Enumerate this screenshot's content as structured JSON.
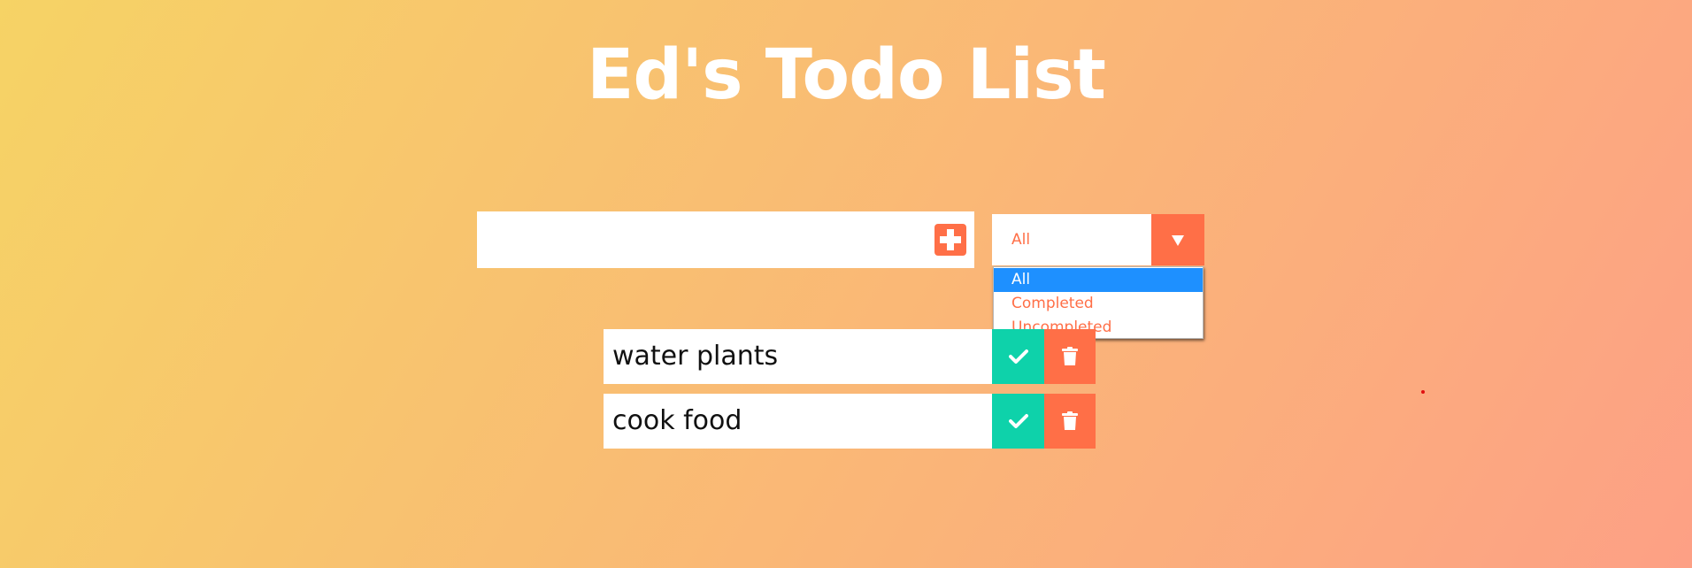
{
  "header": {
    "title": "Ed's Todo List"
  },
  "form": {
    "input_value": "",
    "input_placeholder": "",
    "add_icon": "plus-square-icon"
  },
  "filter": {
    "selected": "All",
    "caret_icon": "caret-down-icon",
    "options": [
      {
        "label": "All",
        "highlighted": true
      },
      {
        "label": "Completed",
        "highlighted": false
      },
      {
        "label": "Uncompleted",
        "highlighted": false
      }
    ]
  },
  "todos": [
    {
      "text": "water plants",
      "complete_icon": "check-icon",
      "delete_icon": "trash-icon"
    },
    {
      "text": "cook food",
      "complete_icon": "check-icon",
      "delete_icon": "trash-icon"
    }
  ],
  "colors": {
    "gradient_start": "#f6d365",
    "gradient_end": "#fda085",
    "accent": "#ff6f47",
    "complete": "#0ed2aa",
    "option_highlight": "#1e90ff",
    "title": "#ffffff"
  }
}
